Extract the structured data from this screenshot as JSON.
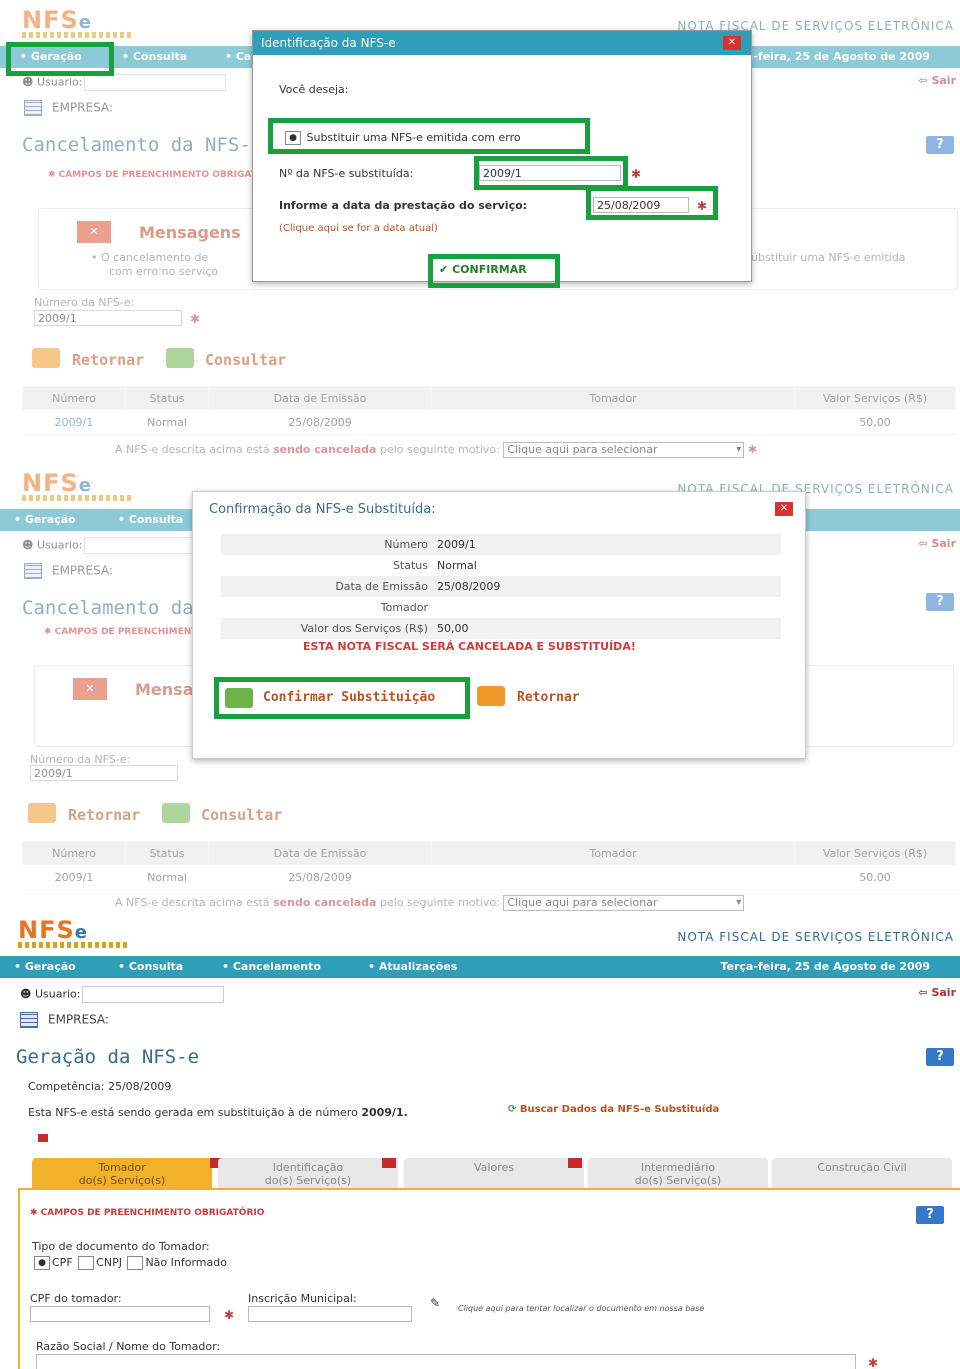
{
  "header": {
    "logo": "NFS",
    "logo_e": "e",
    "site_title": "NOTA FISCAL DE SERVIÇOS ELETRÔNICA",
    "menu": [
      "• Geração",
      "• Consulta",
      "• Cancelamento",
      "• Atualizações"
    ],
    "date": "Terça-feira, 25 de Agosto de 2009",
    "user_label": "Usuario:",
    "exit_label": "Sair",
    "company_label": "EMPRESA:"
  },
  "panel1": {
    "page_title": "Cancelamento da NFS-e",
    "required_note": "✱ CAMPOS DE PREENCHIMENTO OBRIGATÓRIO",
    "messages_title": "Mensagens",
    "message_text_left": "• O cancelamento de",
    "message_text_left2": "com erro no serviço",
    "message_text_right": "ubstituir uma NFS-e emitida",
    "nfse_number_label": "Número da NFS-e:",
    "nfse_number_value": "2009/1",
    "return_label": "Retornar",
    "consult_label": "Consultar",
    "table_headers": [
      "Número",
      "Status",
      "Data de Emissão",
      "Tomador",
      "Valor Serviços (R$)"
    ],
    "table_row": [
      "2009/1",
      "Normal",
      "25/08/2009",
      "",
      "50,00"
    ],
    "motivo_text_a": "A NFS-e descrita acima está ",
    "motivo_text_b": "sendo cancelada",
    "motivo_text_c": " pelo seguinte motivo:",
    "motivo_select": "Clique aqui para selecionar",
    "dialog": {
      "title": "Identificação da NFS-e",
      "question": "Você deseja:",
      "option": "Substituir uma NFS-e emitida com erro",
      "substituted_label": "Nº da NFS-e substituída:",
      "substituted_value": "2009/1",
      "date_label": "Informe a data da prestação do serviço:",
      "date_value": "25/08/2009",
      "today_link": "(Clique aqui se for a data atual)",
      "confirm_label": "CONFIRMAR"
    }
  },
  "panel2": {
    "dialog": {
      "title": "Confirmação da NFS-e Substituída:",
      "rows": [
        {
          "label": "Número",
          "value": "2009/1"
        },
        {
          "label": "Status",
          "value": "Normal"
        },
        {
          "label": "Data de Emissão",
          "value": "25/08/2009"
        },
        {
          "label": "Tomador",
          "value": ""
        },
        {
          "label": "Valor dos Serviços (R$)",
          "value": "50,00"
        }
      ],
      "warning": "ESTA NOTA FISCAL SERÁ CANCELADA E SUBSTITUÍDA!",
      "confirm_label": "Confirmar Substituição",
      "return_label": "Retornar"
    }
  },
  "panel3": {
    "page_title": "Geração da NFS-e",
    "competencia": "Competência: 25/08/2009",
    "substitution_text": "Esta NFS-e está sendo gerada em substituição à de número ",
    "substitution_number": "2009/1.",
    "search_link": "Buscar Dados da NFS-e Substituída",
    "tabs": [
      {
        "l1": "Tomador",
        "l2": "do(s) Serviço(s)"
      },
      {
        "l1": "Identificação",
        "l2": "do(s) Serviço(s)"
      },
      {
        "l1": "Valores",
        "l2": ""
      },
      {
        "l1": "Intermediário",
        "l2": "do(s) Serviço(s)"
      },
      {
        "l1": "Construção Civil",
        "l2": ""
      }
    ],
    "required_note": "✱ CAMPOS DE PREENCHIMENTO OBRIGATÓRIO",
    "doc_type_label": "Tipo de documento do Tomador:",
    "doc_options": [
      "CPF",
      "CNPJ",
      "Não Informado"
    ],
    "cpf_label": "CPF do tomador:",
    "im_label": "Inscrição Municipal:",
    "lookup_hint": "Clique aqui para tentar localizar o documento em nossa base",
    "razao_label": "Razão Social / Nome do Tomador:"
  }
}
